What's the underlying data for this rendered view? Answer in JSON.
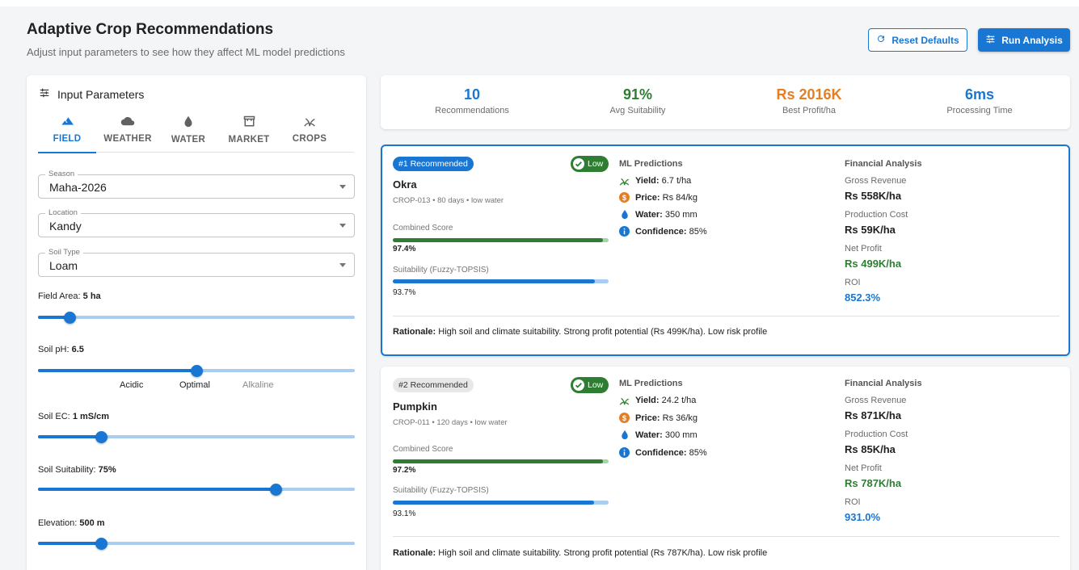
{
  "header": {
    "title": "Adaptive Crop Recommendations",
    "subtitle": "Adjust input parameters to see how they affect ML model predictions",
    "reset_label": "Reset Defaults",
    "run_label": "Run Analysis"
  },
  "colors": {
    "primary": "#1976d2",
    "success": "#2e7d32",
    "warning": "#e67e22",
    "track": "#a9cdee"
  },
  "input_panel": {
    "title": "Input Parameters",
    "tabs": [
      {
        "label": "FIELD",
        "icon": "mountain-icon",
        "active": true
      },
      {
        "label": "WEATHER",
        "icon": "cloud-icon",
        "active": false
      },
      {
        "label": "WATER",
        "icon": "water-drop-icon",
        "active": false
      },
      {
        "label": "MARKET",
        "icon": "store-icon",
        "active": false
      },
      {
        "label": "CROPS",
        "icon": "grass-icon",
        "active": false
      }
    ],
    "season": {
      "label": "Season",
      "value": "Maha-2026"
    },
    "location": {
      "label": "Location",
      "value": "Kandy"
    },
    "soil_type": {
      "label": "Soil Type",
      "value": "Loam"
    },
    "field_area": {
      "label": "Field Area:",
      "value": "5 ha",
      "level": 0.1
    },
    "soil_ph": {
      "label": "Soil pH:",
      "value": "6.5",
      "level": 0.5,
      "marks": [
        "Acidic",
        "Optimal",
        "Alkaline"
      ]
    },
    "soil_ec": {
      "label": "Soil EC:",
      "value": "1 mS/cm",
      "level": 0.2
    },
    "soil_suitability": {
      "label": "Soil Suitability:",
      "value": "75%",
      "level": 0.75
    },
    "elevation": {
      "label": "Elevation:",
      "value": "500 m",
      "level": 0.2
    }
  },
  "stats": [
    {
      "value": "10",
      "label": "Recommendations",
      "color": "#1976d2"
    },
    {
      "value": "91%",
      "label": "Avg Suitability",
      "color": "#2e7d32"
    },
    {
      "value": "Rs 2016K",
      "label": "Best Profit/ha",
      "color": "#e67e22"
    },
    {
      "value": "6ms",
      "label": "Processing Time",
      "color": "#1976d2"
    }
  ],
  "labels": {
    "ml_predictions": "ML Predictions",
    "financial_analysis": "Financial Analysis",
    "combined_score": "Combined Score",
    "suitability": "Suitability (Fuzzy-TOPSIS)",
    "yield": "Yield:",
    "price": "Price:",
    "water": "Water:",
    "confidence": "Confidence:",
    "gross_revenue": "Gross Revenue",
    "production_cost": "Production Cost",
    "net_profit": "Net Profit",
    "roi": "ROI",
    "rationale": "Rationale:"
  },
  "recommendations": [
    {
      "rank": "#1 Recommended",
      "risk": "Low",
      "name": "Okra",
      "meta": "CROP-013 • 80 days • low water",
      "combined_score": "97.4%",
      "combined_level": 0.974,
      "suitability": "93.7%",
      "suitability_level": 0.937,
      "yield": "6.7 t/ha",
      "price": "Rs 84/kg",
      "water": "350 mm",
      "confidence": "85%",
      "gross_revenue": "Rs 558K/ha",
      "production_cost": "Rs 59K/ha",
      "net_profit": "Rs 499K/ha",
      "roi": "852.3%",
      "rationale": "High soil and climate suitability. Strong profit potential (Rs 499K/ha). Low risk profile"
    },
    {
      "rank": "#2 Recommended",
      "risk": "Low",
      "name": "Pumpkin",
      "meta": "CROP-011 • 120 days • low water",
      "combined_score": "97.2%",
      "combined_level": 0.972,
      "suitability": "93.1%",
      "suitability_level": 0.931,
      "yield": "24.2 t/ha",
      "price": "Rs 36/kg",
      "water": "300 mm",
      "confidence": "85%",
      "gross_revenue": "Rs 871K/ha",
      "production_cost": "Rs 85K/ha",
      "net_profit": "Rs 787K/ha",
      "roi": "931.0%",
      "rationale": "High soil and climate suitability. Strong profit potential (Rs 787K/ha). Low risk profile"
    }
  ]
}
